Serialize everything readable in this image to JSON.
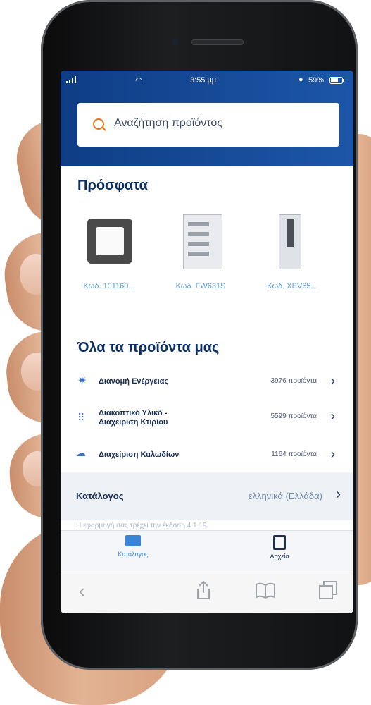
{
  "status_bar": {
    "time": "3:55 μμ",
    "battery": "59%"
  },
  "search": {
    "placeholder": "Αναζήτηση προϊόντος"
  },
  "recent": {
    "title": "Πρόσφατα",
    "items": [
      {
        "label": "Κωδ. 101160..."
      },
      {
        "label": "Κωδ. FW631S"
      },
      {
        "label": "Κωδ. XEV65..."
      }
    ]
  },
  "products": {
    "title": "Όλα τα προϊόντα μας",
    "categories": [
      {
        "label": "Διανομή Ενέργειας",
        "count": "3976 προϊόντα"
      },
      {
        "label_line1": "Διακοπτικό Υλικό -",
        "label_line2": "Διαχείριση Κτιρίου",
        "count": "5599 προϊόντα"
      },
      {
        "label": "Διαχείριση Καλωδίων",
        "count": "1164 προϊόντα"
      }
    ]
  },
  "catalog": {
    "label": "Κατάλογος",
    "value": "ελληνικά (Ελλάδα)",
    "version_note": "Η εφαρμογή σας τρέχει την έκδοση 4.1.19"
  },
  "tabs": [
    {
      "label": "Κατάλογος"
    },
    {
      "label": "Αρχεία"
    }
  ],
  "colors": {
    "brand_blue": "#1d56a8",
    "accent_orange": "#e47a1e",
    "link_blue": "#5e9bd6"
  }
}
